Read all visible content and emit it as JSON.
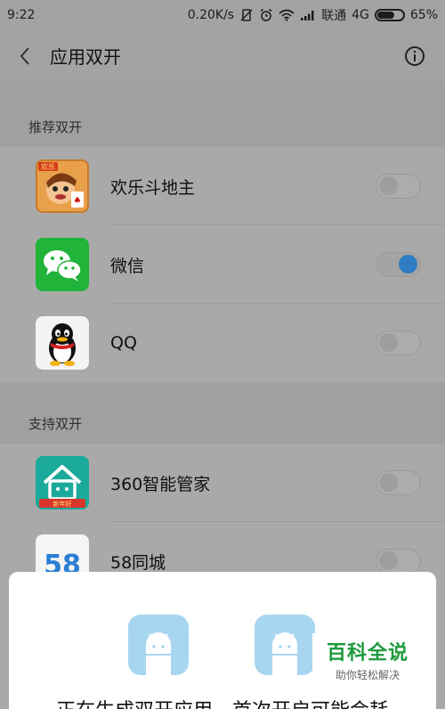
{
  "status_bar": {
    "time": "9:22",
    "network_speed": "0.20K/s",
    "carrier": "联通",
    "network_type": "4G",
    "battery": "65%",
    "battery_level": 0.65
  },
  "header": {
    "title": "应用双开"
  },
  "sections": [
    {
      "title": "推荐双开",
      "apps": [
        {
          "name": "欢乐斗地主",
          "enabled": false,
          "icon": "doudizhu-app-icon",
          "badge": "欢乐"
        },
        {
          "name": "微信",
          "enabled": true,
          "icon": "wechat-app-icon"
        },
        {
          "name": "QQ",
          "enabled": false,
          "icon": "qq-app-icon"
        }
      ]
    },
    {
      "title": "支持双开",
      "apps": [
        {
          "name": "360智能管家",
          "enabled": false,
          "icon": "360-smart-home-app-icon",
          "badge": "新年好"
        },
        {
          "name": "58同城",
          "enabled": false,
          "icon": "58-tongcheng-app-icon",
          "badge": "58"
        }
      ]
    }
  ],
  "dialog": {
    "message": "正在生成双开应用，首次开启可能会耗"
  },
  "watermark": {
    "brand": "百科全说",
    "slogan": "助你轻松解决"
  },
  "colors": {
    "toggle_on": "#2e7dc4",
    "wechat_green": "#21b33a",
    "android_tile": "#a8d6f0",
    "watermark_green": "#1d9a3d"
  }
}
